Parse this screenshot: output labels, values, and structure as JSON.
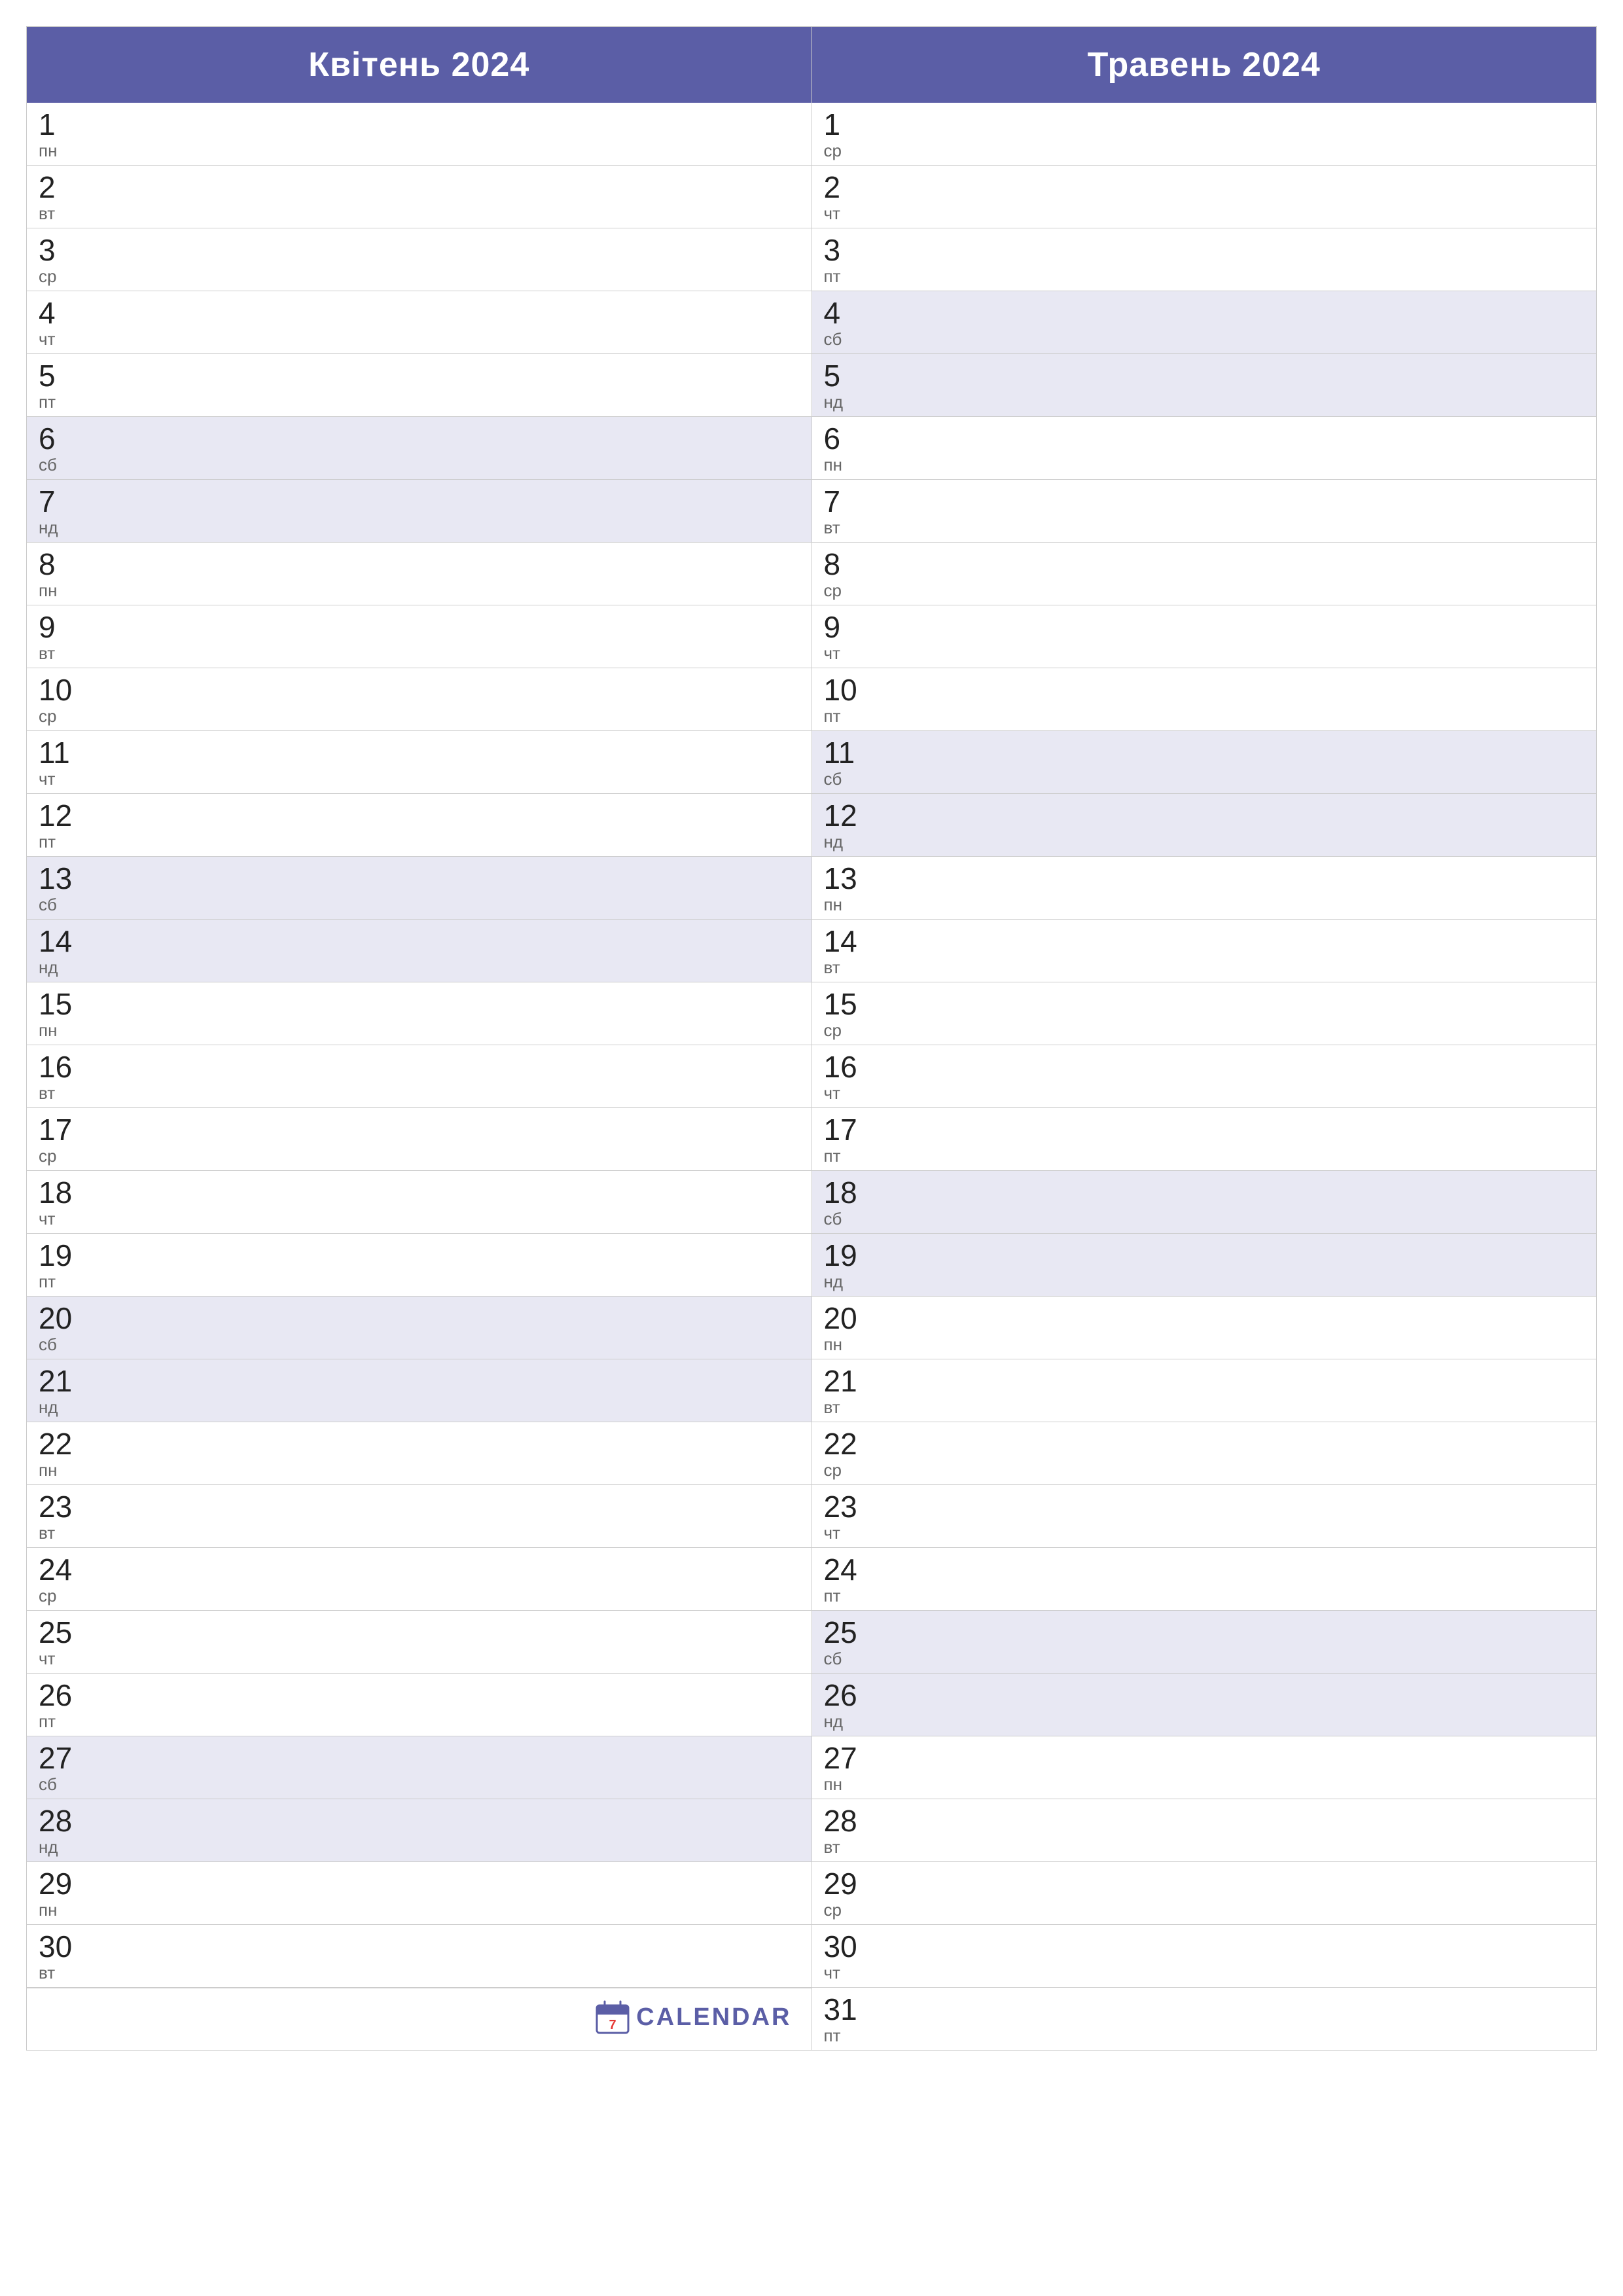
{
  "months": [
    {
      "id": "april",
      "title": "Квітень 2024",
      "days": [
        {
          "num": "1",
          "name": "пн",
          "weekend": false
        },
        {
          "num": "2",
          "name": "вт",
          "weekend": false
        },
        {
          "num": "3",
          "name": "ср",
          "weekend": false
        },
        {
          "num": "4",
          "name": "чт",
          "weekend": false
        },
        {
          "num": "5",
          "name": "пт",
          "weekend": false
        },
        {
          "num": "6",
          "name": "сб",
          "weekend": true
        },
        {
          "num": "7",
          "name": "нд",
          "weekend": true
        },
        {
          "num": "8",
          "name": "пн",
          "weekend": false
        },
        {
          "num": "9",
          "name": "вт",
          "weekend": false
        },
        {
          "num": "10",
          "name": "ср",
          "weekend": false
        },
        {
          "num": "11",
          "name": "чт",
          "weekend": false
        },
        {
          "num": "12",
          "name": "пт",
          "weekend": false
        },
        {
          "num": "13",
          "name": "сб",
          "weekend": true
        },
        {
          "num": "14",
          "name": "нд",
          "weekend": true
        },
        {
          "num": "15",
          "name": "пн",
          "weekend": false
        },
        {
          "num": "16",
          "name": "вт",
          "weekend": false
        },
        {
          "num": "17",
          "name": "ср",
          "weekend": false
        },
        {
          "num": "18",
          "name": "чт",
          "weekend": false
        },
        {
          "num": "19",
          "name": "пт",
          "weekend": false
        },
        {
          "num": "20",
          "name": "сб",
          "weekend": true
        },
        {
          "num": "21",
          "name": "нд",
          "weekend": true
        },
        {
          "num": "22",
          "name": "пн",
          "weekend": false
        },
        {
          "num": "23",
          "name": "вт",
          "weekend": false
        },
        {
          "num": "24",
          "name": "ср",
          "weekend": false
        },
        {
          "num": "25",
          "name": "чт",
          "weekend": false
        },
        {
          "num": "26",
          "name": "пт",
          "weekend": false
        },
        {
          "num": "27",
          "name": "сб",
          "weekend": true
        },
        {
          "num": "28",
          "name": "нд",
          "weekend": true
        },
        {
          "num": "29",
          "name": "пн",
          "weekend": false
        },
        {
          "num": "30",
          "name": "вт",
          "weekend": false
        }
      ]
    },
    {
      "id": "may",
      "title": "Травень 2024",
      "days": [
        {
          "num": "1",
          "name": "ср",
          "weekend": false
        },
        {
          "num": "2",
          "name": "чт",
          "weekend": false
        },
        {
          "num": "3",
          "name": "пт",
          "weekend": false
        },
        {
          "num": "4",
          "name": "сб",
          "weekend": true
        },
        {
          "num": "5",
          "name": "нд",
          "weekend": true
        },
        {
          "num": "6",
          "name": "пн",
          "weekend": false
        },
        {
          "num": "7",
          "name": "вт",
          "weekend": false
        },
        {
          "num": "8",
          "name": "ср",
          "weekend": false
        },
        {
          "num": "9",
          "name": "чт",
          "weekend": false
        },
        {
          "num": "10",
          "name": "пт",
          "weekend": false
        },
        {
          "num": "11",
          "name": "сб",
          "weekend": true
        },
        {
          "num": "12",
          "name": "нд",
          "weekend": true
        },
        {
          "num": "13",
          "name": "пн",
          "weekend": false
        },
        {
          "num": "14",
          "name": "вт",
          "weekend": false
        },
        {
          "num": "15",
          "name": "ср",
          "weekend": false
        },
        {
          "num": "16",
          "name": "чт",
          "weekend": false
        },
        {
          "num": "17",
          "name": "пт",
          "weekend": false
        },
        {
          "num": "18",
          "name": "сб",
          "weekend": true
        },
        {
          "num": "19",
          "name": "нд",
          "weekend": true
        },
        {
          "num": "20",
          "name": "пн",
          "weekend": false
        },
        {
          "num": "21",
          "name": "вт",
          "weekend": false
        },
        {
          "num": "22",
          "name": "ср",
          "weekend": false
        },
        {
          "num": "23",
          "name": "чт",
          "weekend": false
        },
        {
          "num": "24",
          "name": "пт",
          "weekend": false
        },
        {
          "num": "25",
          "name": "сб",
          "weekend": true
        },
        {
          "num": "26",
          "name": "нд",
          "weekend": true
        },
        {
          "num": "27",
          "name": "пн",
          "weekend": false
        },
        {
          "num": "28",
          "name": "вт",
          "weekend": false
        },
        {
          "num": "29",
          "name": "ср",
          "weekend": false
        },
        {
          "num": "30",
          "name": "чт",
          "weekend": false
        },
        {
          "num": "31",
          "name": "пт",
          "weekend": false
        }
      ]
    }
  ],
  "logo": {
    "num": "7",
    "text": "CALENDAR"
  }
}
